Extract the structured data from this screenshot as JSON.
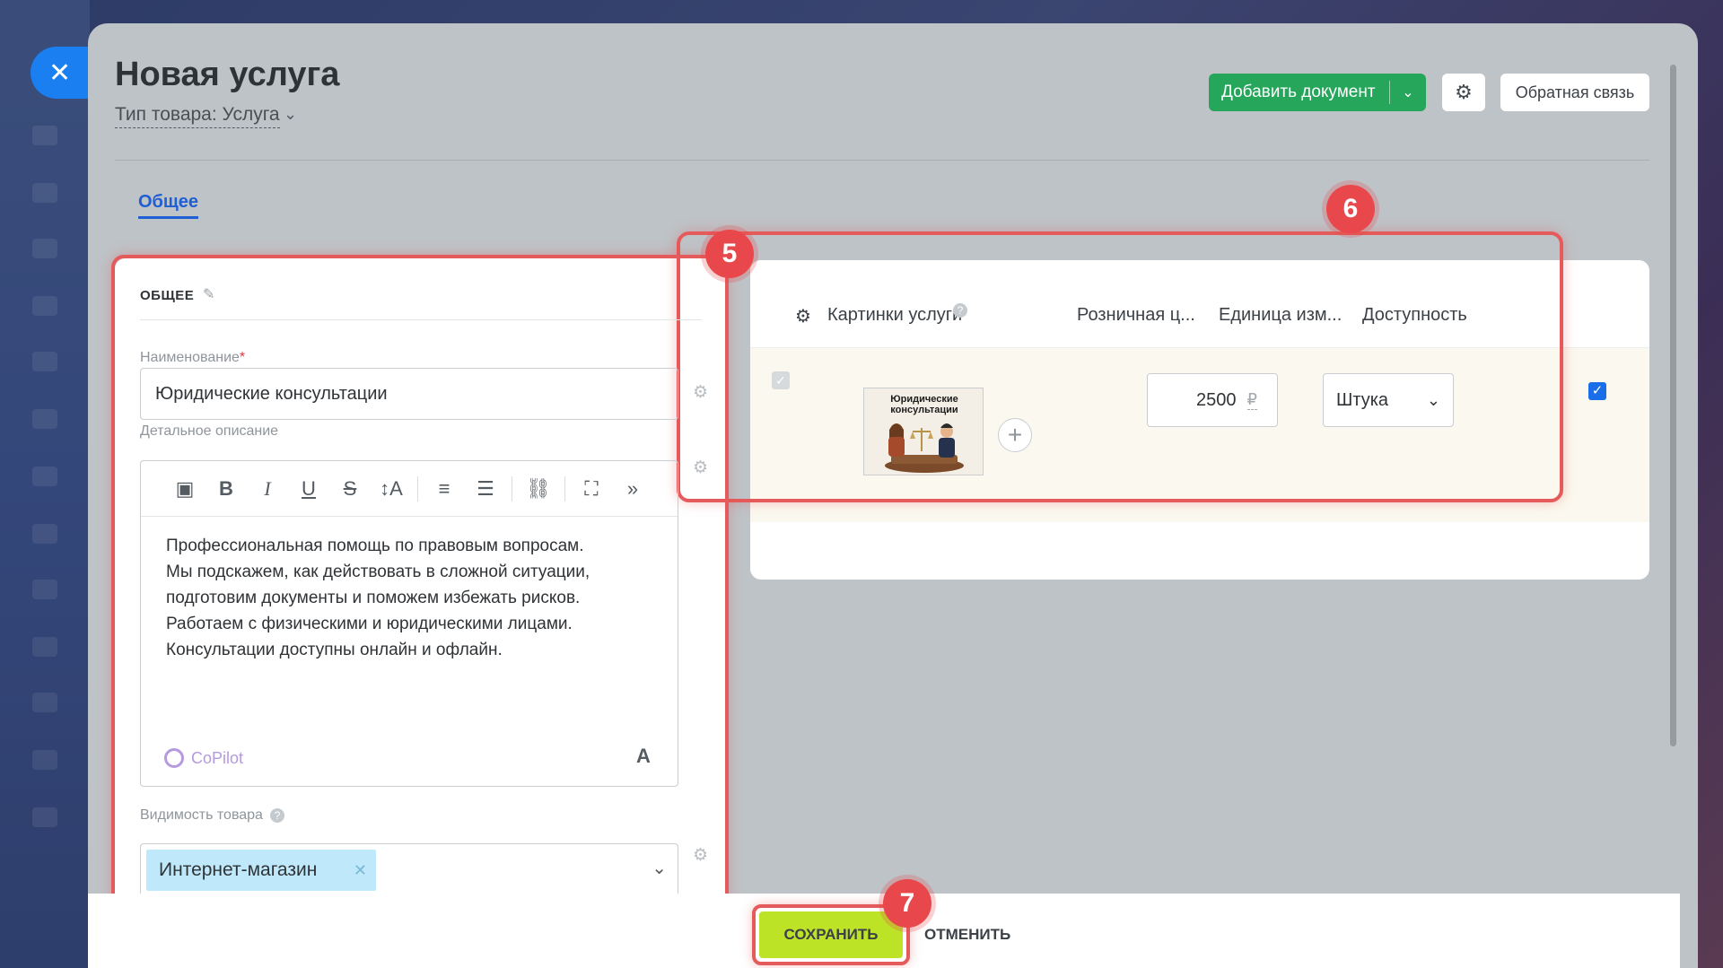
{
  "header": {
    "title": "Новая услуга",
    "product_type": "Тип товара: Услуга",
    "add_document": "Добавить документ",
    "feedback": "Обратная связь"
  },
  "tabs": [
    {
      "label": "Общее"
    }
  ],
  "general": {
    "section_title": "ОБЩЕЕ",
    "name_label": "Наименование",
    "name_required": "*",
    "name_value": "Юридические консультации",
    "description_label": "Детальное описание",
    "description_lines": [
      "Профессиональная помощь по правовым вопросам.",
      "Мы подскажем, как действовать в сложной ситуации,",
      "подготовим документы и поможем избежать рисков.",
      "Работаем с физическими и юридическими лицами.",
      "Консультации доступны онлайн и офлайн."
    ],
    "copilot": "CoPilot",
    "font_button": "A",
    "visibility_label": "Видимость товара",
    "visibility_chip": "Интернет-магазин"
  },
  "grid": {
    "columns": [
      "Картинки услуги",
      "Розничная ц...",
      "Единица изм...",
      "Доступность"
    ],
    "row": {
      "thumbnail_caption": "Юридические консультации",
      "price": "2500",
      "currency": "₽",
      "unit": "Штука",
      "available": true
    }
  },
  "footer": {
    "save": "СОХРАНИТЬ",
    "cancel": "ОТМЕНИТЬ"
  },
  "annotations": [
    "5",
    "6",
    "7"
  ],
  "colors": {
    "accent_blue": "#1f5ed3",
    "doc_button": "#26a65b",
    "save_button": "#bde327",
    "highlight": "#e55a5a"
  }
}
